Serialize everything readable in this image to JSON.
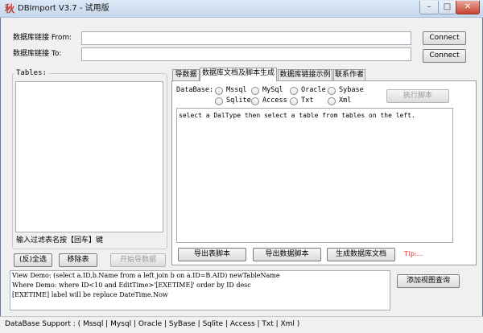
{
  "window": {
    "title": "DBImport V3.7 - 试用版",
    "app_icon": "秋",
    "min_glyph": "–",
    "max_glyph": "□",
    "close_glyph": "✕"
  },
  "connection": {
    "from_label": "数据库链接 From:",
    "to_label": "数据库链接 To:",
    "from_value": "",
    "to_value": "",
    "connect_label": "Connect"
  },
  "tables": {
    "group_title": "Tables:",
    "filter_hint": "输入过滤表名按【回车】键",
    "select_all": "(反)全选",
    "remove_table": "移除表",
    "start_import": "开始导数据"
  },
  "tabs": [
    {
      "label": "导数据"
    },
    {
      "label": "数据库文档及脚本生成"
    },
    {
      "label": "数据库链接示例"
    },
    {
      "label": "联系作者"
    }
  ],
  "script_panel": {
    "database_label": "DataBase:",
    "db_options": [
      "Mssql",
      "MySql",
      "Oracle",
      "Sybase",
      "Sqlite",
      "Access",
      "Txt",
      "Xml"
    ],
    "execute_button": "执行脚本",
    "editor_text": "select a DalType then select a table from tables on the left.",
    "export_table_script": "导出表脚本",
    "export_data_script": "导出数据脚本",
    "generate_doc": "生成数据库文档",
    "tip": "Tip:..."
  },
  "view_query": {
    "lines": [
      "View  Demo: (select a.ID,b.Name from a left join b on a.ID=B.AID) newTableName",
      "Where Demo: where ID<10 and EditTime>'[EXETIME]' order by ID desc",
      "[EXETIME] label will be replace DateTime.Now"
    ],
    "add_view_button": "添加视图查询"
  },
  "status": {
    "text": "DataBase Support : ( Mssql | Mysql | Oracle | SyBase | Sqlite | Access | Txt | Xml )"
  }
}
